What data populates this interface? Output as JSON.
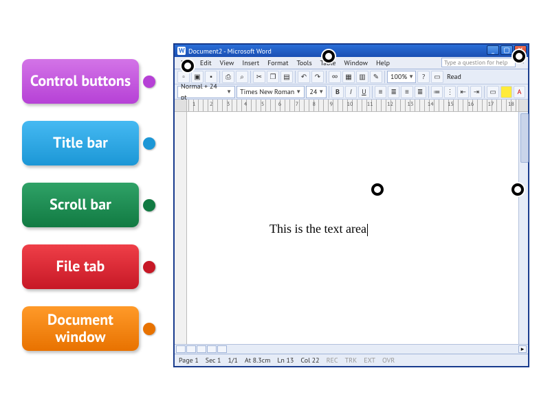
{
  "labels": {
    "control_buttons": "Control buttons",
    "title_bar": "Title bar",
    "scroll_bar": "Scroll bar",
    "file_tab": "File tab",
    "document_window": "Document window"
  },
  "word": {
    "title": "Document2 - Microsoft Word",
    "menu": {
      "file": "File",
      "edit": "Edit",
      "view": "View",
      "insert": "Insert",
      "format": "Format",
      "tools": "Tools",
      "table": "Table",
      "window": "Window",
      "help": "Help"
    },
    "help_placeholder": "Type a question for help",
    "formatting": {
      "style": "Normal + 24 pt",
      "font": "Times New Roman",
      "size": "24",
      "zoom": "100%",
      "read": "Read"
    },
    "ruler_numbers": [
      "1",
      "2",
      "3",
      "4",
      "5",
      "6",
      "7",
      "8",
      "9",
      "10",
      "11",
      "12",
      "13",
      "14",
      "15",
      "16",
      "17",
      "18"
    ],
    "body_text": "This is the text area",
    "status": {
      "page": "Page 1",
      "sec": "Sec 1",
      "pages": "1/1",
      "at": "At 8.3cm",
      "ln": "Ln 13",
      "col": "Col 22",
      "rec": "REC",
      "trk": "TRK",
      "ext": "EXT",
      "ovr": "OVR"
    }
  }
}
